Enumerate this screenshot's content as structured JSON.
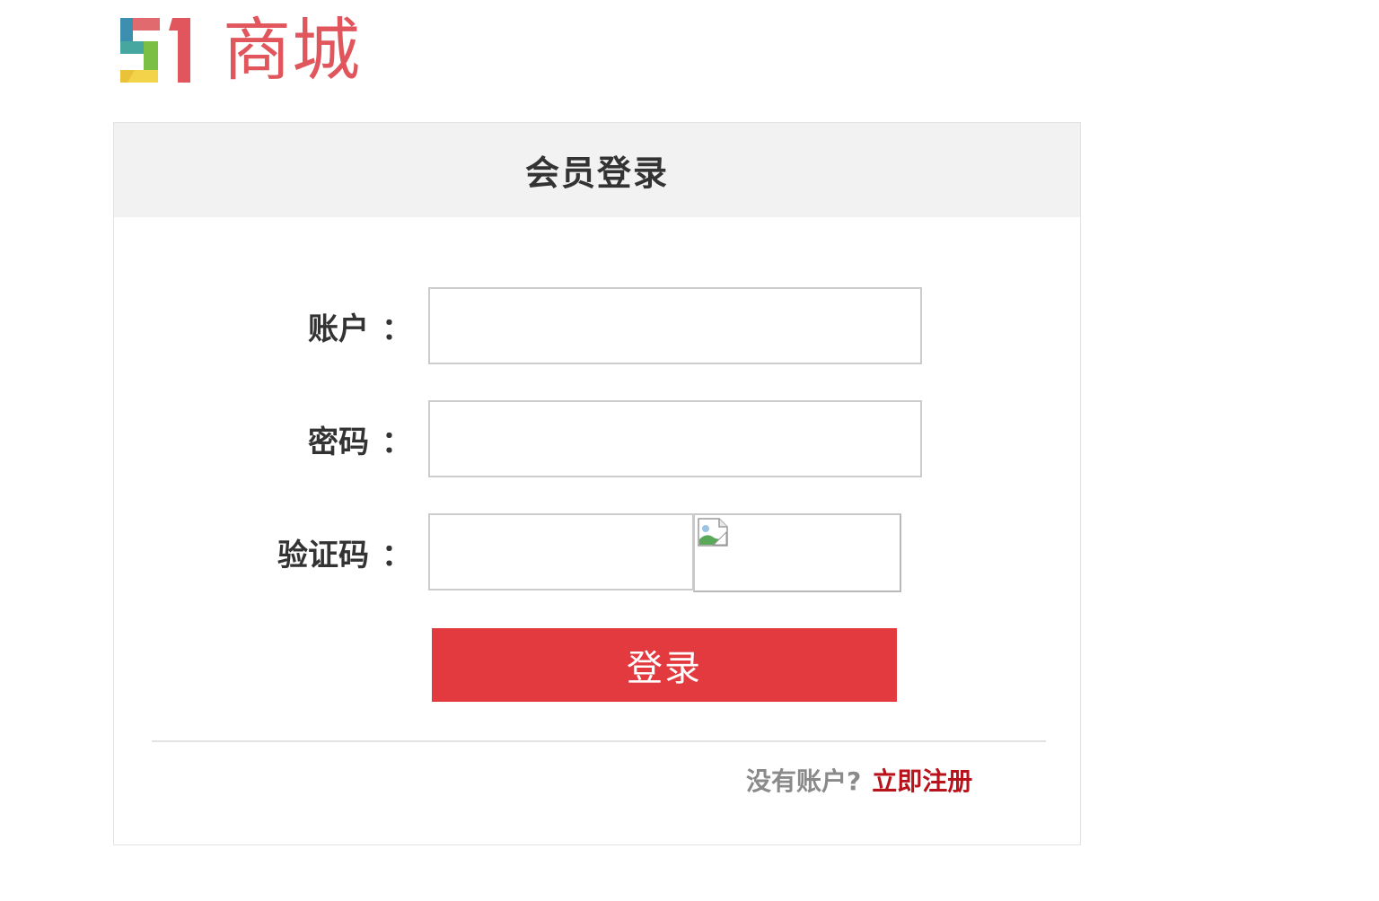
{
  "logo": {
    "brand_text": "商城",
    "mark_text": "51"
  },
  "login": {
    "title": "会员登录",
    "fields": {
      "account": {
        "label": "账户",
        "colon": "：",
        "value": "",
        "placeholder": ""
      },
      "password": {
        "label": "密码",
        "colon": "：",
        "value": "",
        "placeholder": ""
      },
      "captcha": {
        "label": "验证码",
        "colon": "：",
        "value": "",
        "placeholder": ""
      }
    },
    "submit_label": "登录",
    "no_account_text": "没有账户?",
    "register_link": "立即注册"
  },
  "colors": {
    "accent": "#e23a3f",
    "link": "#b8121b",
    "header_bg": "#f2f2f2",
    "logo_text": "#e0565c"
  },
  "icons": {
    "captcha": "broken-image-icon"
  }
}
